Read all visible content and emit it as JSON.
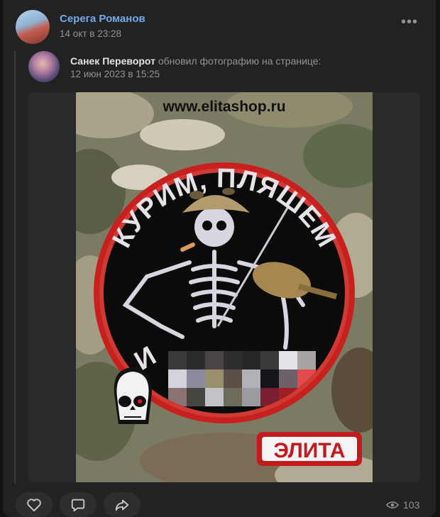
{
  "post": {
    "author": "Серега Романов",
    "date": "14 окт в 23:28",
    "menu_icon": "more-horizontal-icon"
  },
  "repost": {
    "author": "Санек Переворот",
    "action": "обновил фотографию на странице:",
    "date": "12 июн 2023 в 15:25"
  },
  "photo": {
    "watermark": "www.elitashop.ru",
    "patch_text_top": "КУРИМ, ПЛЯШЕМ",
    "patch_text_bottom": "И",
    "brand_logo": "ЭЛИТА",
    "colors": {
      "patch_red": "#c8201e",
      "patch_black": "#0b0b0b",
      "thread_white": "#e6e2e8"
    }
  },
  "footer": {
    "like_icon": "heart-icon",
    "comment_icon": "comment-icon",
    "share_icon": "share-icon",
    "views_icon": "eye-icon",
    "views": "103"
  },
  "theme": {
    "link": "#71aaeb",
    "muted": "#939393",
    "card": "#222222"
  }
}
